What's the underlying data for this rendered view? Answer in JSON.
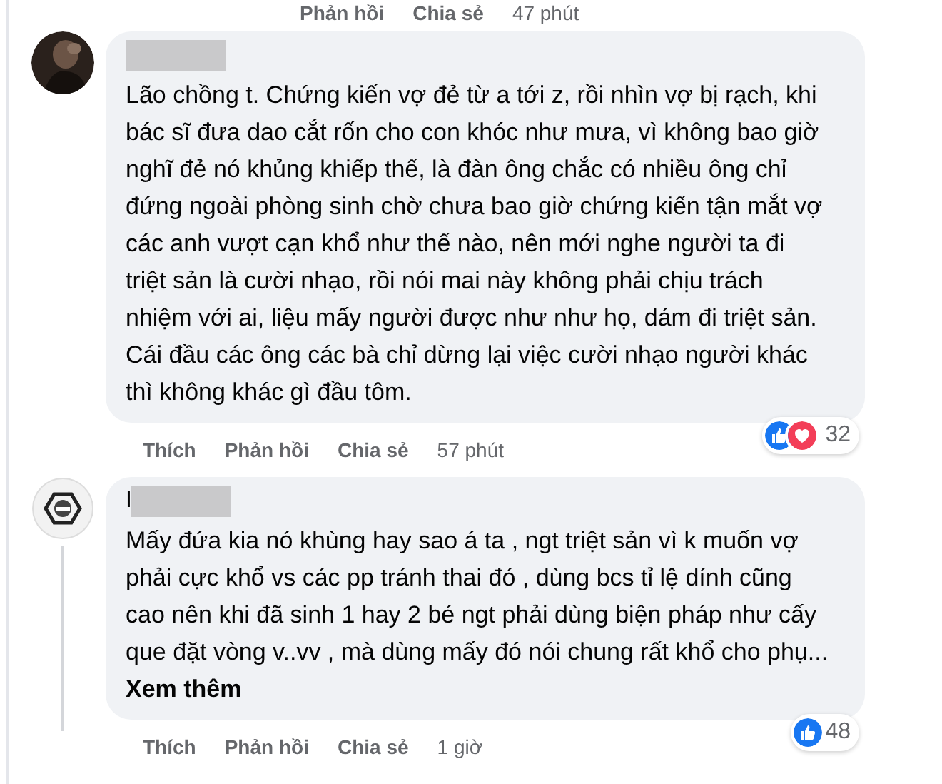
{
  "top_actions": {
    "items": [
      "Phản hồi",
      "Chia sẻ",
      "47 phút"
    ]
  },
  "comments": [
    {
      "avatar": {
        "kind": "picture"
      },
      "text": "Lão chồng t. Chứng kiến vợ đẻ từ a tới z, rồi nhìn vợ bị rạch, khi bác sĩ đưa dao cắt rốn cho con khóc như mưa, vì không bao giờ nghĩ đẻ nó khủng khiếp thế, là đàn ông chắc có nhiều ông chỉ đứng ngoài phòng sinh chờ chưa bao giờ chứng kiến tận mắt vợ các anh vượt cạn khổ như thế nào, nên mới nghe người ta đi triệt sản là cười nhạo, rồi nói mai này không phải chịu trách nhiệm với ai, liệu mấy người được như như họ, dám đi triệt sản. Cái đầu các ông các bà chỉ dừng lại việc cười nhạo người khác thì không khác gì đầu tôm.",
      "reactions": [
        {
          "kind": "like"
        },
        {
          "kind": "love"
        }
      ],
      "reaction_count": "32",
      "actions": [
        "Thích",
        "Phản hồi",
        "Chia sẻ"
      ],
      "time": "57 phút"
    },
    {
      "name": "I",
      "text": "Mấy đứa kia nó khùng hay sao á ta , ngt triệt sản vì k muốn vợ phải cực khổ vs các pp tránh thai đó , dùng bcs tỉ lệ dính cũng cao nên khi đã sinh 1 hay 2 bé ngt phải dùng biện pháp như cấy que đặt vòng v..vv , mà dùng mấy đó nói chung rất khổ cho phụ...",
      "see_more": "Xem thêm",
      "reactions": [
        {
          "kind": "like"
        }
      ],
      "reaction_count": "48",
      "actions": [
        "Thích",
        "Phản hồi",
        "Chia sẻ"
      ],
      "time": "1 giờ"
    }
  ]
}
